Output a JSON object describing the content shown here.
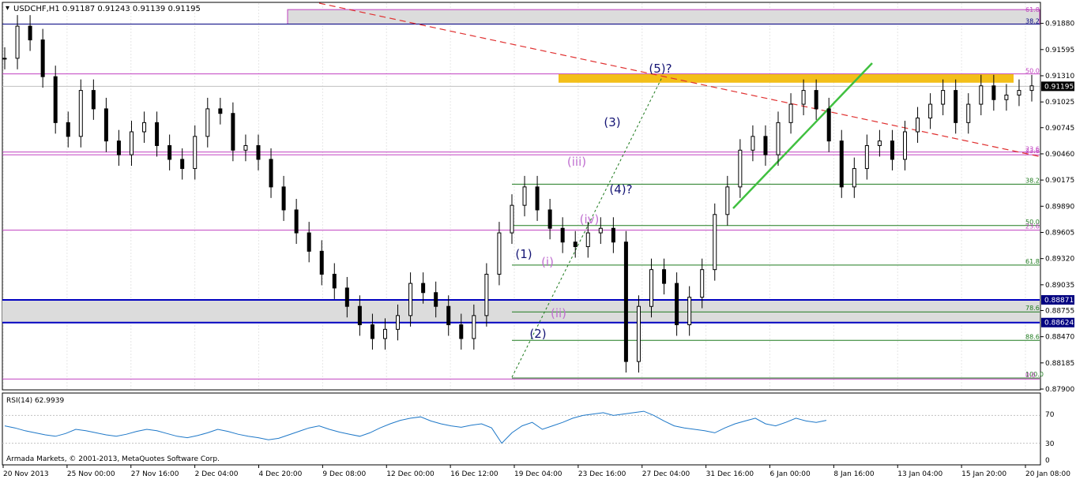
{
  "header": {
    "symbol_line": "USDCHF,H1  0.91187 0.91243 0.91139 0.91195",
    "menu_icon": "triangle-down-icon"
  },
  "rsi_panel": {
    "label": "RSI(14) 62.9939",
    "levels": [
      "70",
      "30",
      "0"
    ],
    "copyright": "Armada Markets, © 2001-2013, MetaQuotes Software Corp."
  },
  "time_axis": {
    "labels": [
      "20 Nov 2013",
      "25 Nov 00:00",
      "27 Nov 16:00",
      "2 Dec 04:00",
      "4 Dec 20:00",
      "9 Dec 08:00",
      "12 Dec 00:00",
      "16 Dec 12:00",
      "19 Dec 04:00",
      "23 Dec 16:00",
      "27 Dec 04:00",
      "31 Dec 16:00",
      "6 Jan 00:00",
      "8 Jan 16:00",
      "13 Jan 04:00",
      "15 Jan 20:00",
      "20 Jan 08:00"
    ]
  },
  "colors": {
    "bull": "#1a1a1a",
    "bear": "#1a1a1a",
    "fib_green": "#1e7a1e",
    "fib_magenta": "#c040c0",
    "trend_red": "#e03030",
    "trend_green": "#40c040",
    "resistance": "#f2b800",
    "support": "#0000c0",
    "wave_blue": "#151575",
    "wave_violet": "#c070d0",
    "rsi": "#1e78c8"
  },
  "chart_data": {
    "type": "candlestick",
    "symbol": "USDCHF",
    "timeframe": "H1",
    "ylim": [
      0.879,
      0.921
    ],
    "price_ticks": [
      "0.91880",
      "0.91595",
      "0.91310",
      "0.91025",
      "0.90745",
      "0.90460",
      "0.90175",
      "0.89890",
      "0.89605",
      "0.89320",
      "0.89035",
      "0.88755",
      "0.88470",
      "0.88185",
      "0.87900"
    ],
    "current_price": "0.91195",
    "support_zone": {
      "upper": "0.88871",
      "lower": "0.88624"
    },
    "resistance_zone": {
      "low": 0.9126,
      "high": 0.9131
    },
    "fib_lines_right": [
      {
        "price": 0.9045,
        "label": "23.6",
        "color": "magenta"
      },
      {
        "price": 0.9013,
        "label": "38.2",
        "color": "green"
      },
      {
        "price": 0.8968,
        "label": "50.0",
        "color": "green"
      },
      {
        "price": 0.8963,
        "label": "23.6",
        "color": "magenta"
      },
      {
        "price": 0.8925,
        "label": "61.8",
        "color": "green"
      },
      {
        "price": 0.8874,
        "label": "78.6",
        "color": "green"
      },
      {
        "price": 0.8843,
        "label": "88.6",
        "color": "green"
      },
      {
        "price": 0.8802,
        "label": "100.0",
        "color": "green"
      },
      {
        "price": 0.8801,
        "label": "0.0",
        "color": "magenta"
      }
    ],
    "fib_top": [
      {
        "price": 0.9203,
        "label": "61.8"
      },
      {
        "price": 0.9195,
        "label": "38.2"
      },
      {
        "price": 0.9133,
        "label": "50.0"
      },
      {
        "price": 0.9048,
        "label": "23.6"
      }
    ],
    "wave_labels": [
      "(1)",
      "(2)",
      "(3)",
      "(4)?",
      "(5)?",
      "(i)",
      "(ii)",
      "(iii)",
      "(iv)"
    ],
    "series": [
      {
        "name": "close",
        "values": [
          0.915,
          0.9185,
          0.917,
          0.913,
          0.908,
          0.9065,
          0.9115,
          0.9095,
          0.906,
          0.9045,
          0.907,
          0.908,
          0.9055,
          0.904,
          0.903,
          0.9065,
          0.9095,
          0.909,
          0.905,
          0.9055,
          0.904,
          0.901,
          0.8985,
          0.896,
          0.894,
          0.8915,
          0.89,
          0.888,
          0.886,
          0.8845,
          0.8855,
          0.887,
          0.8905,
          0.8895,
          0.888,
          0.886,
          0.8845,
          0.887,
          0.8915,
          0.896,
          0.899,
          0.901,
          0.8985,
          0.8965,
          0.895,
          0.8945,
          0.896,
          0.8965,
          0.895,
          0.882,
          0.888,
          0.892,
          0.8905,
          0.886,
          0.889,
          0.892,
          0.898,
          0.901,
          0.905,
          0.9065,
          0.9045,
          0.908,
          0.91,
          0.9115,
          0.9095,
          0.906,
          0.901,
          0.903,
          0.9055,
          0.906,
          0.904,
          0.907,
          0.9085,
          0.91,
          0.9115,
          0.908,
          0.91,
          0.912,
          0.9105,
          0.911,
          0.9115,
          0.912
        ]
      }
    ],
    "rsi": {
      "name": "RSI(14)",
      "last": 62.9939,
      "levels": [
        70,
        30
      ],
      "values": [
        55,
        52,
        48,
        45,
        42,
        40,
        44,
        50,
        48,
        45,
        42,
        40,
        43,
        47,
        50,
        48,
        44,
        40,
        38,
        41,
        45,
        50,
        47,
        43,
        40,
        38,
        35,
        37,
        42,
        47,
        52,
        55,
        50,
        46,
        43,
        40,
        45,
        52,
        58,
        63,
        66,
        68,
        62,
        58,
        55,
        53,
        56,
        58,
        52,
        30,
        45,
        55,
        60,
        50,
        55,
        60,
        66,
        70,
        72,
        74,
        70,
        72,
        74,
        76,
        70,
        62,
        55,
        52,
        50,
        48,
        45,
        52,
        58,
        62,
        66,
        58,
        55,
        60,
        66,
        62,
        60,
        63
      ]
    }
  }
}
